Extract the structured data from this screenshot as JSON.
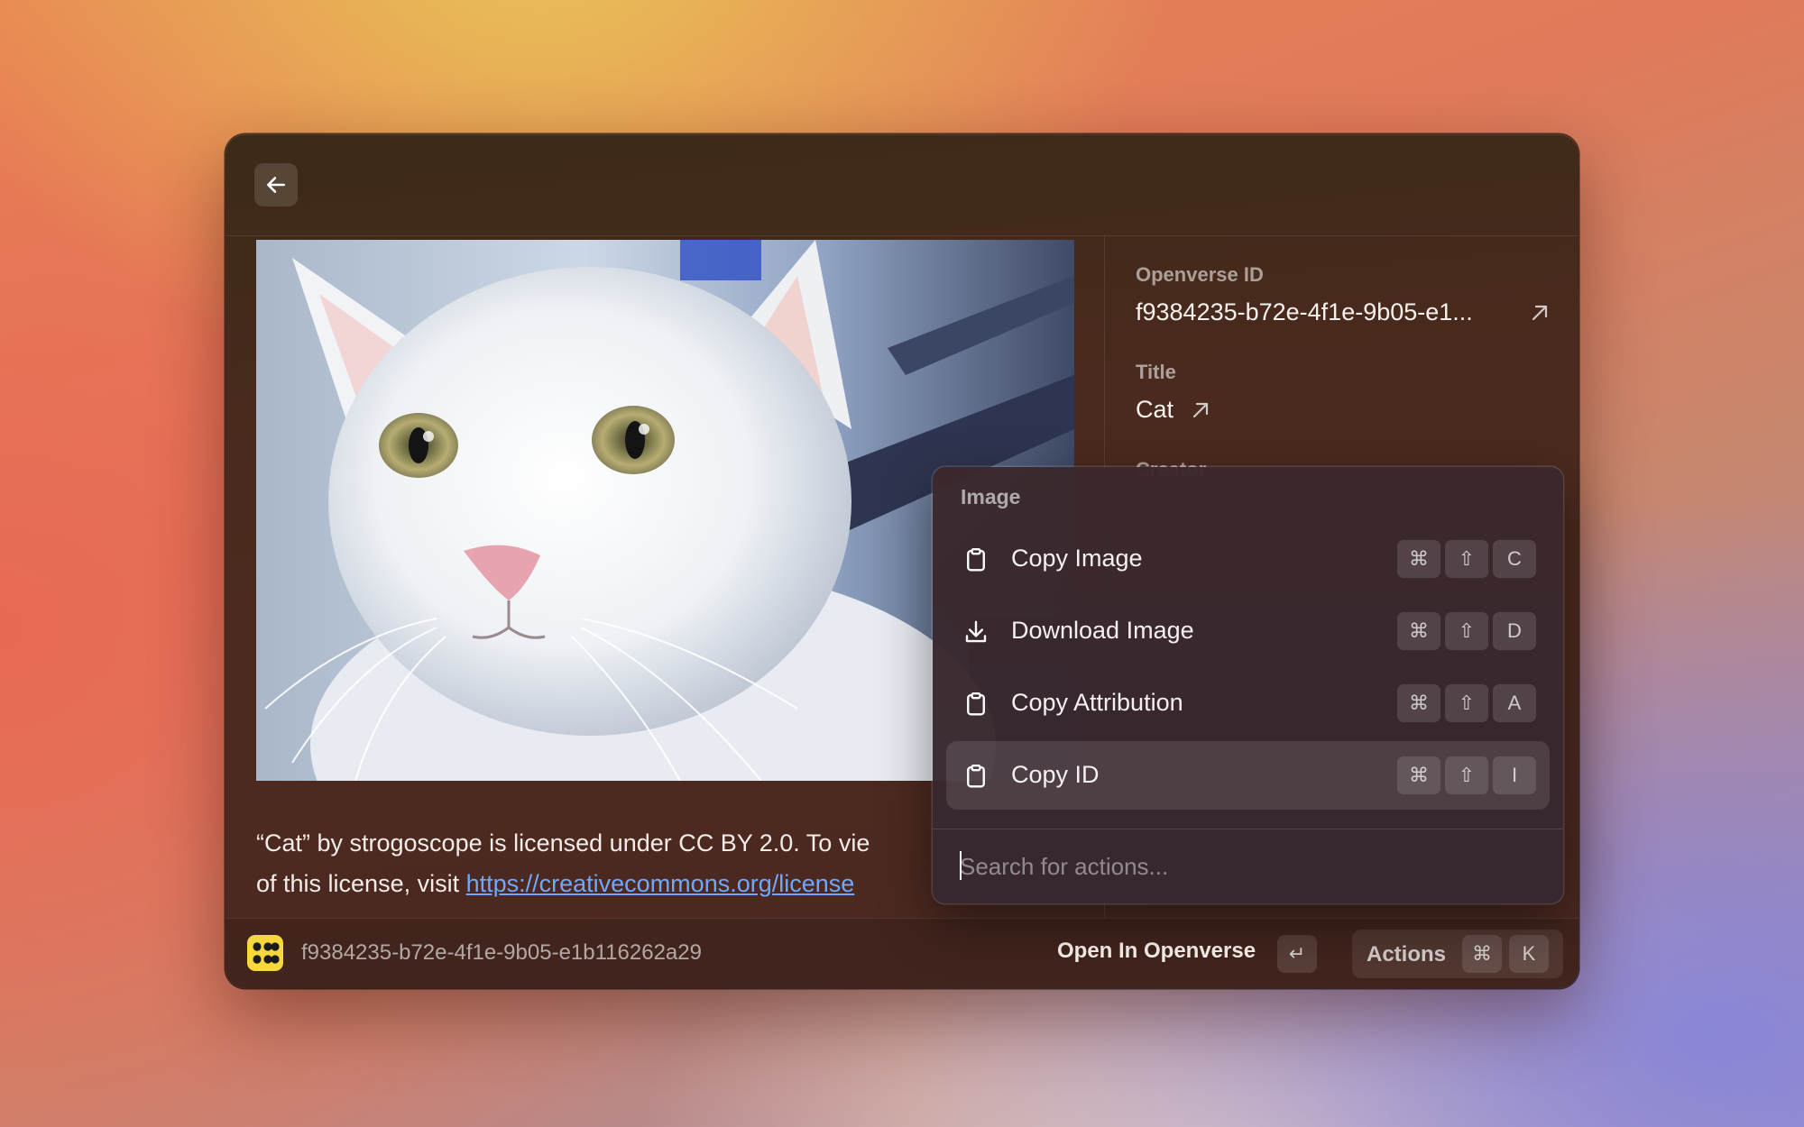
{
  "detail": {
    "openverse_id_label": "Openverse ID",
    "openverse_id_value": "f9384235-b72e-4f1e-9b05-e1...",
    "title_label": "Title",
    "title_value": "Cat",
    "creator_label_partial": "Creator"
  },
  "license": {
    "line1": "“Cat” by strogoscope is licensed under CC BY 2.0. To vie",
    "line2_prefix": "of this license, visit ",
    "link_text": "https://creativecommons.org/license"
  },
  "footer": {
    "image_id": "f9384235-b72e-4f1e-9b05-e1b116262a29",
    "primary_action": "Open In Openverse",
    "primary_key": "↵",
    "actions_label": "Actions",
    "actions_keys": [
      "⌘",
      "K"
    ]
  },
  "action_panel": {
    "section_title": "Image",
    "items": [
      {
        "label": "Copy Image",
        "icon": "clipboard-icon",
        "keys": [
          "⌘",
          "⇧",
          "C"
        ]
      },
      {
        "label": "Download Image",
        "icon": "download-icon",
        "keys": [
          "⌘",
          "⇧",
          "D"
        ]
      },
      {
        "label": "Copy Attribution",
        "icon": "clipboard-icon",
        "keys": [
          "⌘",
          "⇧",
          "A"
        ]
      },
      {
        "label": "Copy ID",
        "icon": "clipboard-icon",
        "keys": [
          "⌘",
          "⇧",
          "I"
        ],
        "selected": true
      }
    ],
    "search_placeholder": "Search for actions..."
  },
  "colors": {
    "link": "#6ea8ff",
    "logo": "#f7d83c",
    "window_bg": "#4a2a1e"
  }
}
